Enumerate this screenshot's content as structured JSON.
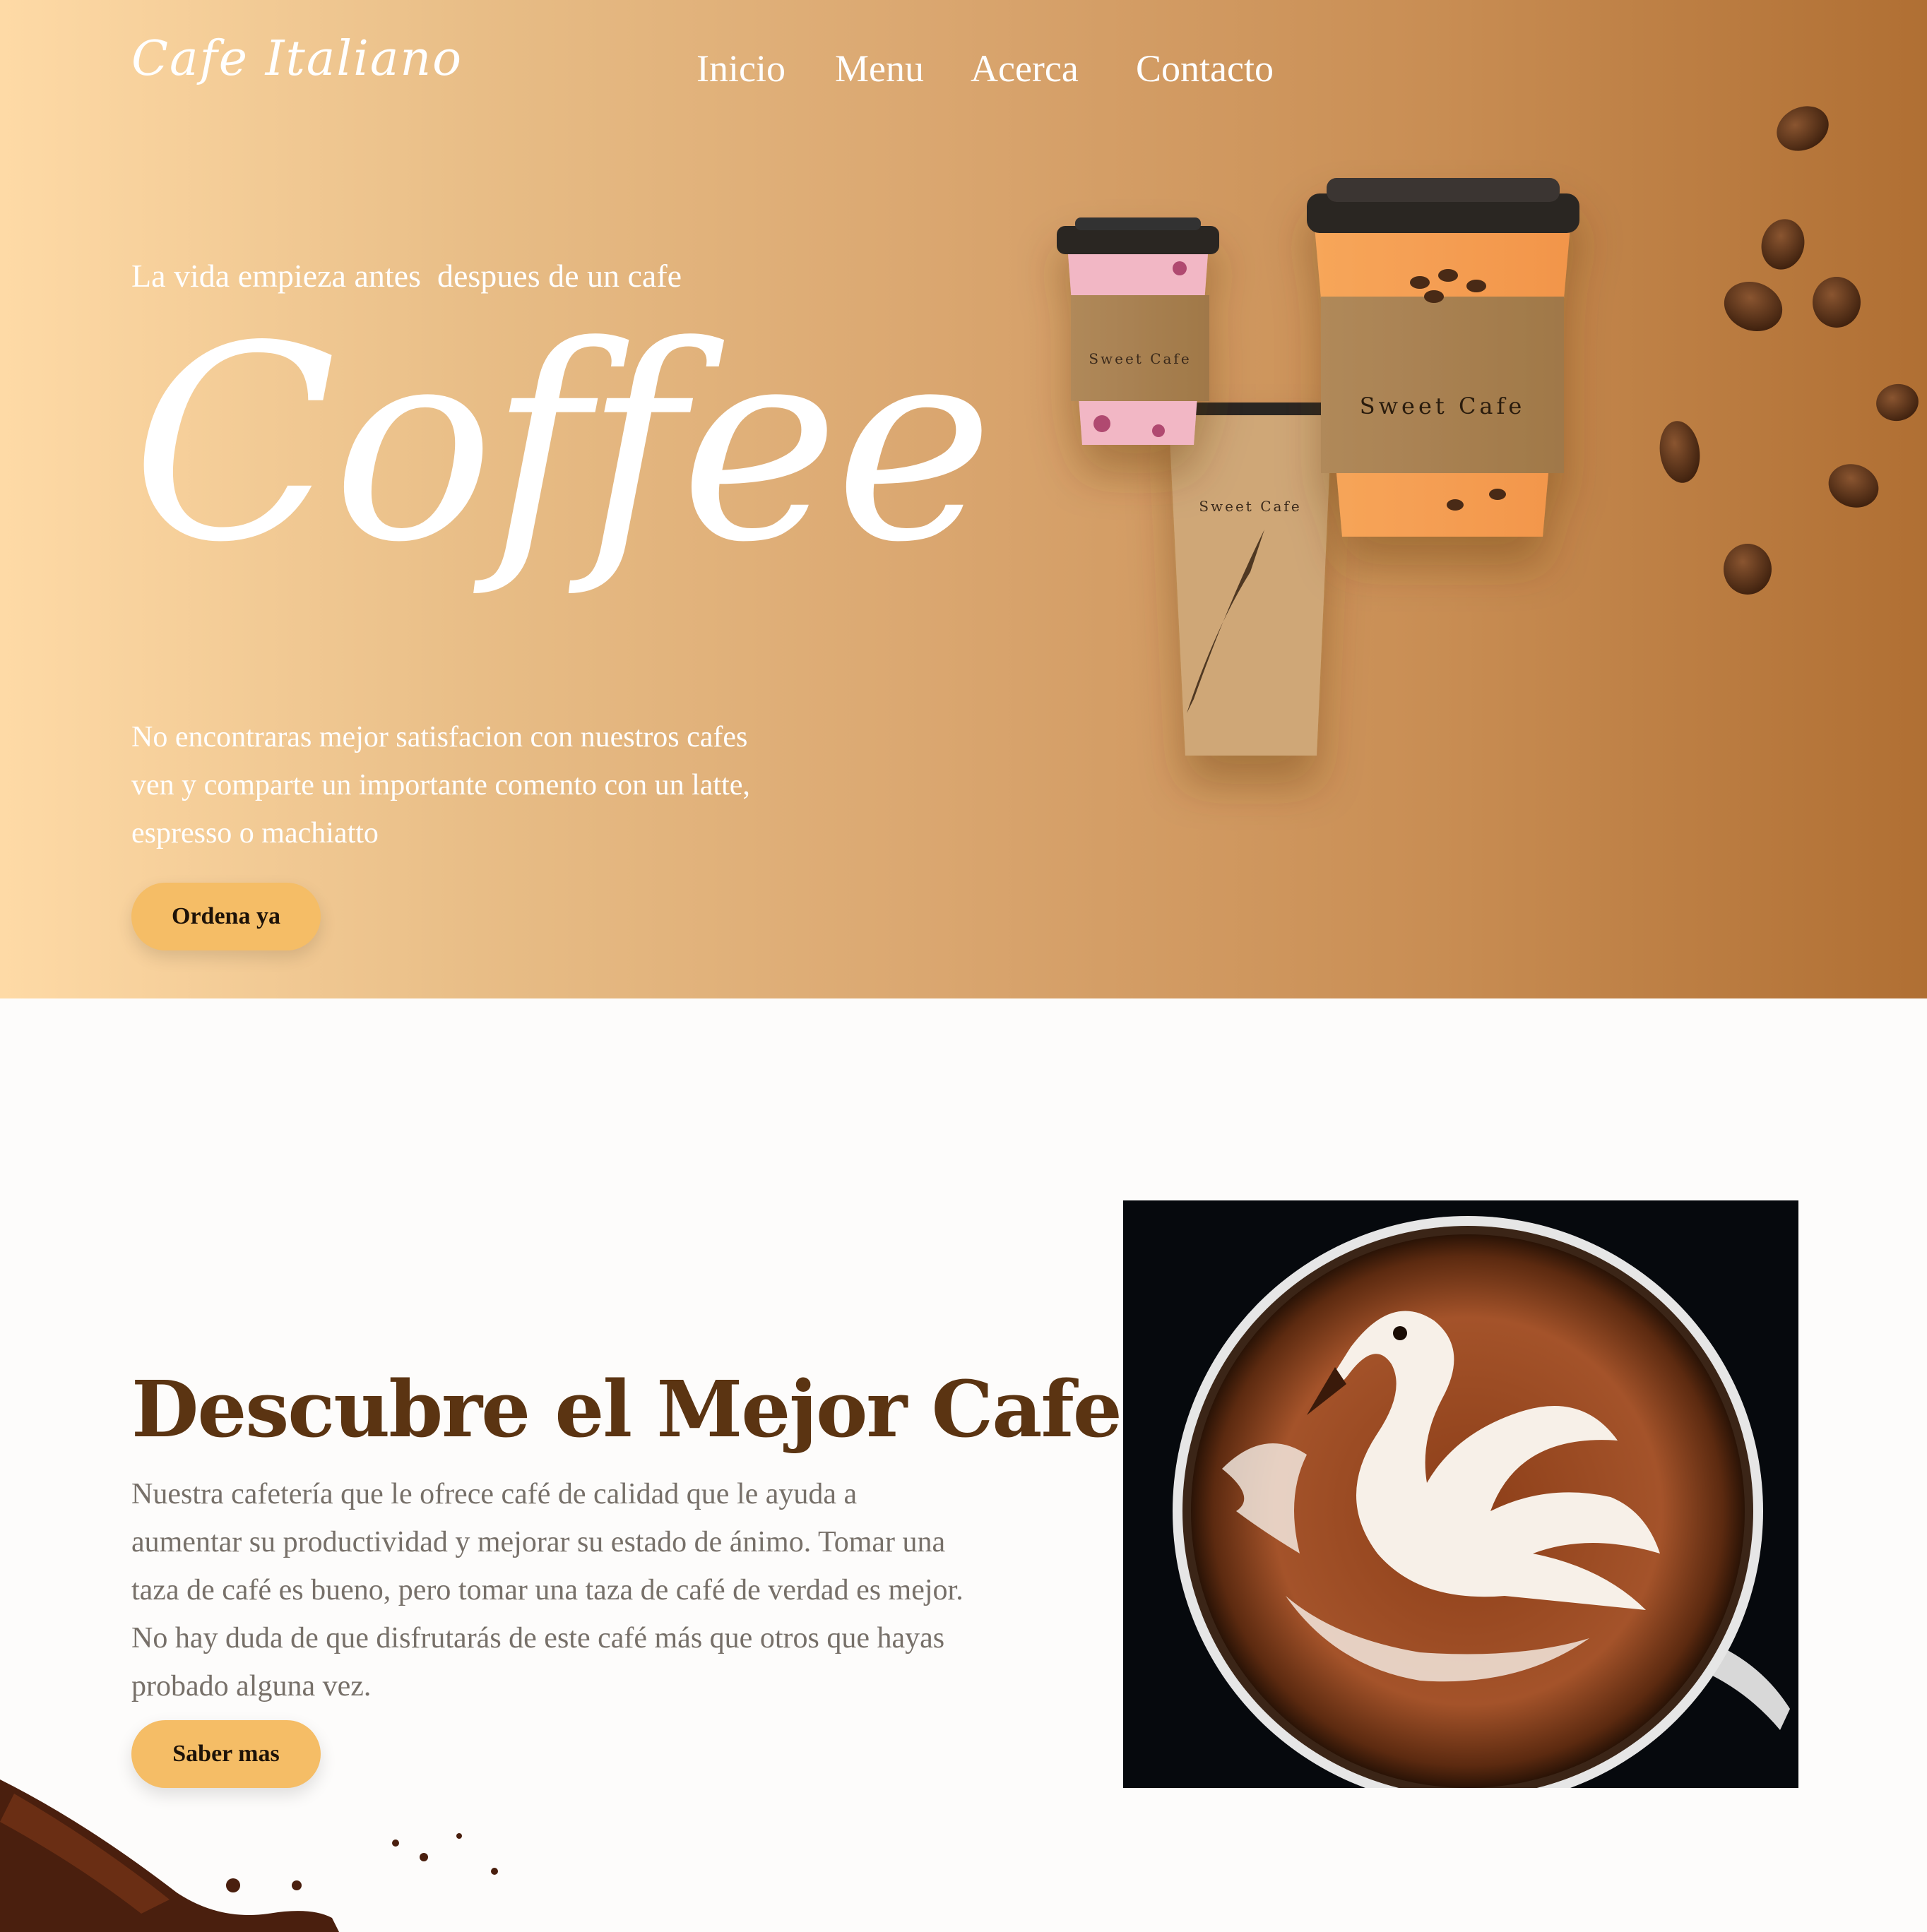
{
  "brand": {
    "logo_text": "Cafe Italiano"
  },
  "nav": {
    "items": [
      {
        "label": "Inicio"
      },
      {
        "label": "Menu"
      },
      {
        "label": "Acerca"
      },
      {
        "label": "Contacto"
      }
    ]
  },
  "hero": {
    "tagline": "La vida empieza antes  despues de un cafe",
    "headline": "Coffee",
    "description": "No  encontraras mejor satisfacion con nuestros cafes\nven y comparte un importante comento con un latte,\nespresso o machiatto",
    "cta_label": "Ordena ya",
    "image": {
      "icon": "coffee-cups-illustration",
      "cup_brand_text": "Sweet Cafe"
    }
  },
  "discover": {
    "title": "Descubre el Mejor Cafe",
    "body": "Nuestra cafetería que le ofrece café de calidad que le ayuda a aumentar su productividad y mejorar su estado de ánimo. Tomar una taza de café es bueno, pero tomar una taza de café de verdad es mejor. No hay duda de que disfrutarás de este café más que otros que hayas probado alguna vez.",
    "cta_label": "Saber mas",
    "image_icon": "latte-art-swan-image"
  },
  "colors": {
    "hero_gradient_start": "#fedaa6",
    "hero_gradient_end": "#b06f33",
    "button": "#f5bd66",
    "title_brown": "#5b3412",
    "body_text": "#777069"
  }
}
